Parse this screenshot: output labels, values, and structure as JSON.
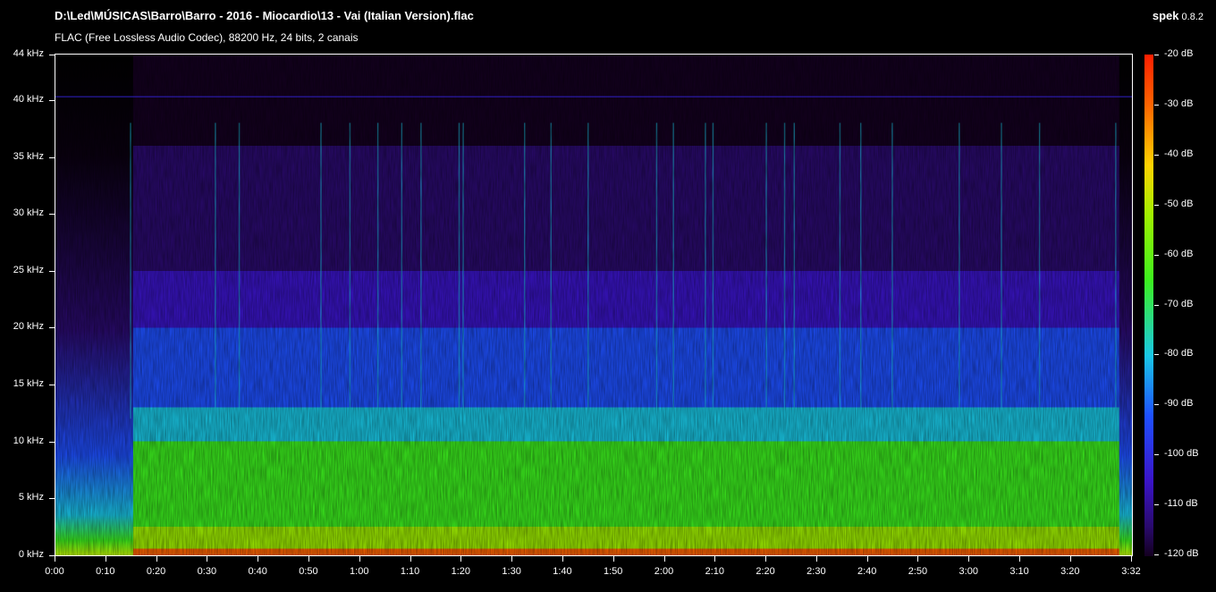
{
  "header": {
    "file_path": "D:\\Led\\MÚSICAS\\Barro\\Barro - 2016 - Miocardio\\13 - Vai (Italian Version).flac",
    "audio_info": "FLAC (Free Lossless Audio Codec), 88200 Hz, 24 bits, 2 canais",
    "app_name": "spek",
    "app_version": "0.8.2"
  },
  "colors": {
    "background": "#000000",
    "axis": "#ffffff",
    "palette": [
      "#140020",
      "#2a0a6e",
      "#3a14c8",
      "#1e50ff",
      "#19c8e6",
      "#3cf01e",
      "#a0f000",
      "#ffd200",
      "#ff6400",
      "#ff1e00"
    ]
  },
  "chart_data": {
    "type": "heatmap",
    "title": "",
    "xlabel": "",
    "ylabel": "",
    "x_tick_labels": [
      "0:00",
      "0:10",
      "0:20",
      "0:30",
      "0:40",
      "0:50",
      "1:00",
      "1:10",
      "1:20",
      "1:30",
      "1:40",
      "1:50",
      "2:00",
      "2:10",
      "2:20",
      "2:30",
      "2:40",
      "2:50",
      "3:00",
      "3:10",
      "3:20",
      "3:32"
    ],
    "x_tick_seconds": [
      0,
      10,
      20,
      30,
      40,
      50,
      60,
      70,
      80,
      90,
      100,
      110,
      120,
      130,
      140,
      150,
      160,
      170,
      180,
      190,
      200,
      212
    ],
    "xlim_seconds": [
      0,
      212
    ],
    "y_tick_labels": [
      "0 kHz",
      "5 kHz",
      "10 kHz",
      "15 kHz",
      "20 kHz",
      "25 kHz",
      "30 kHz",
      "35 kHz",
      "40 kHz",
      "44 kHz"
    ],
    "y_tick_khz": [
      0,
      5,
      10,
      15,
      20,
      25,
      30,
      35,
      40,
      44
    ],
    "ylim_khz": [
      0,
      44
    ],
    "colorbar_labels": [
      "-20 dB",
      "-30 dB",
      "-40 dB",
      "-50 dB",
      "-60 dB",
      "-70 dB",
      "-80 dB",
      "-90 dB",
      "-100 dB",
      "-110 dB",
      "-120 dB"
    ],
    "colorbar_db": [
      -20,
      -30,
      -40,
      -50,
      -60,
      -70,
      -80,
      -90,
      -100,
      -110,
      -120
    ],
    "db_range": [
      -120,
      -20
    ],
    "bands_khz_to_db": [
      {
        "khz": [
          0,
          0.6
        ],
        "db": -35
      },
      {
        "khz": [
          0.6,
          2.5
        ],
        "db": -50
      },
      {
        "khz": [
          2.5,
          5
        ],
        "db": -60
      },
      {
        "khz": [
          5,
          10
        ],
        "db": -68
      },
      {
        "khz": [
          10,
          13
        ],
        "db": -76
      },
      {
        "khz": [
          13,
          20
        ],
        "db": -90
      },
      {
        "khz": [
          20,
          25
        ],
        "db": -100
      },
      {
        "khz": [
          25,
          36
        ],
        "db": -110
      },
      {
        "khz": [
          36,
          44
        ],
        "db": -120
      }
    ],
    "quiet_sections_seconds": [
      [
        0,
        15.3
      ],
      [
        209.5,
        212
      ]
    ],
    "line_khz": 40.3,
    "transients_seconds": [
      14.8,
      31.5,
      36.2,
      52.3,
      58.0,
      63.5,
      68.2,
      72.0,
      79.5,
      80.3,
      92.4,
      97.6,
      104.9,
      118.4,
      121.7,
      128.0,
      129.5,
      140.0,
      143.6,
      145.5,
      154.5,
      158.6,
      164.8,
      178.0,
      186.3,
      193.8,
      208.8
    ]
  }
}
